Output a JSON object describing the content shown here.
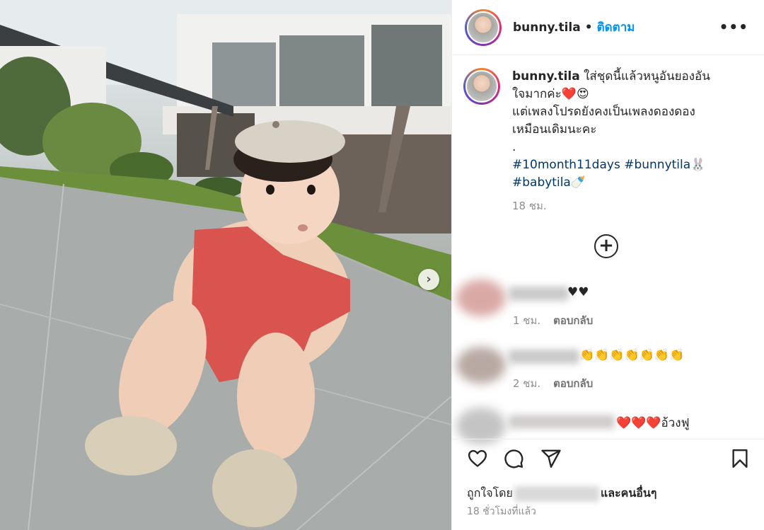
{
  "post": {
    "username": "bunny.tila",
    "separator": "•",
    "follow_label": "ติดตาม",
    "more_label": "•••"
  },
  "caption": {
    "username": "bunny.tila",
    "line1": " ใส่ชุดนี้แล้วหนูอันยองอัน",
    "line2": "ใจมากค่ะ❤️😍",
    "line3": "แต่เพลงโปรดยังคงเป็นเพลงดองดอง",
    "line4": "เหมือนเดิมนะคะ",
    "line5": ".",
    "tag1": "#10month11days",
    "tag2": "#bunnytila",
    "tag2_emoji": "🐰",
    "tag3": "#babytila",
    "tag3_emoji": "🍼",
    "time": "18 ชม."
  },
  "more_comments_icon": "plus-circle-icon",
  "comments": [
    {
      "tail": "♥♥",
      "time": "1 ชม.",
      "reply": "ตอบกลับ"
    },
    {
      "tail": "👏👏👏👏👏👏👏",
      "time": "2 ชม.",
      "reply": "ตอบกลับ"
    },
    {
      "tail": "❤️❤️❤️อ้วงฟู"
    }
  ],
  "actions": {
    "like_icon": "heart-icon",
    "comment_icon": "comment-icon",
    "share_icon": "share-icon",
    "save_icon": "bookmark-icon"
  },
  "likes": {
    "prefix": "ถูกใจโดย",
    "suffix": "และคนอื่นๆ"
  },
  "timestamp": "18 ชั่วโมงที่แล้ว",
  "colors": {
    "link": "#0095f6",
    "hashtag": "#00376b",
    "muted": "#8e8e8e",
    "text": "#262626"
  }
}
